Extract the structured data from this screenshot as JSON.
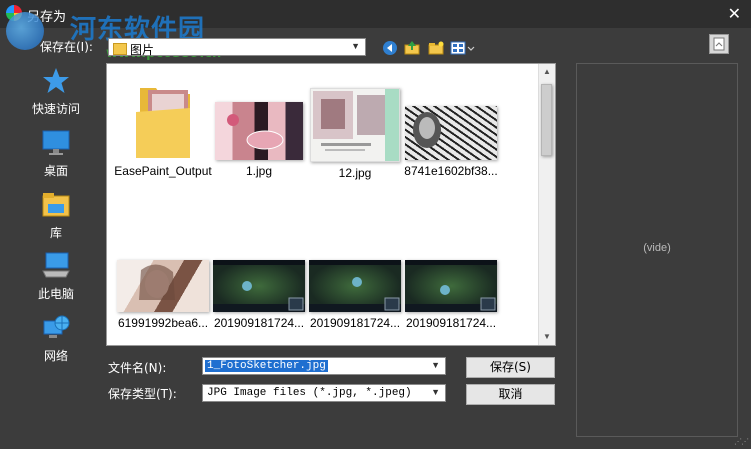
{
  "window": {
    "title": "另存为",
    "close_glyph": "✕"
  },
  "watermark": {
    "text": "河东软件园",
    "url": "www.pc0359.cn"
  },
  "toolbar": {
    "lookin_label": "保存在(I):",
    "lookin_value": "图片",
    "icons": [
      "back-icon",
      "up-folder-icon",
      "new-folder-icon",
      "view-menu-icon"
    ]
  },
  "sidebar": {
    "items": [
      {
        "label": "快速访问",
        "icon": "star-icon"
      },
      {
        "label": "桌面",
        "icon": "desktop-icon"
      },
      {
        "label": "库",
        "icon": "library-icon"
      },
      {
        "label": "此电脑",
        "icon": "computer-icon"
      },
      {
        "label": "网络",
        "icon": "network-icon"
      }
    ]
  },
  "files": [
    {
      "name": "EasePaint_Output",
      "type": "folder"
    },
    {
      "name": "1.jpg",
      "type": "image"
    },
    {
      "name": "12.jpg",
      "type": "image"
    },
    {
      "name": "8741e1602bf38...",
      "type": "image"
    },
    {
      "name": "61991992bea6...",
      "type": "image"
    },
    {
      "name": "201909181724...",
      "type": "image"
    },
    {
      "name": "201909181724...",
      "type": "image"
    },
    {
      "name": "201909181724...",
      "type": "image"
    }
  ],
  "form": {
    "filename_label": "文件名(N):",
    "filename_value": "1_FotoSketcher.jpg",
    "filetype_label": "保存类型(T):",
    "filetype_value": "JPG Image files (*.jpg, *.jpeg)",
    "save_label": "保存(S)",
    "cancel_label": "取消"
  },
  "preview": {
    "text": "(vide)"
  }
}
